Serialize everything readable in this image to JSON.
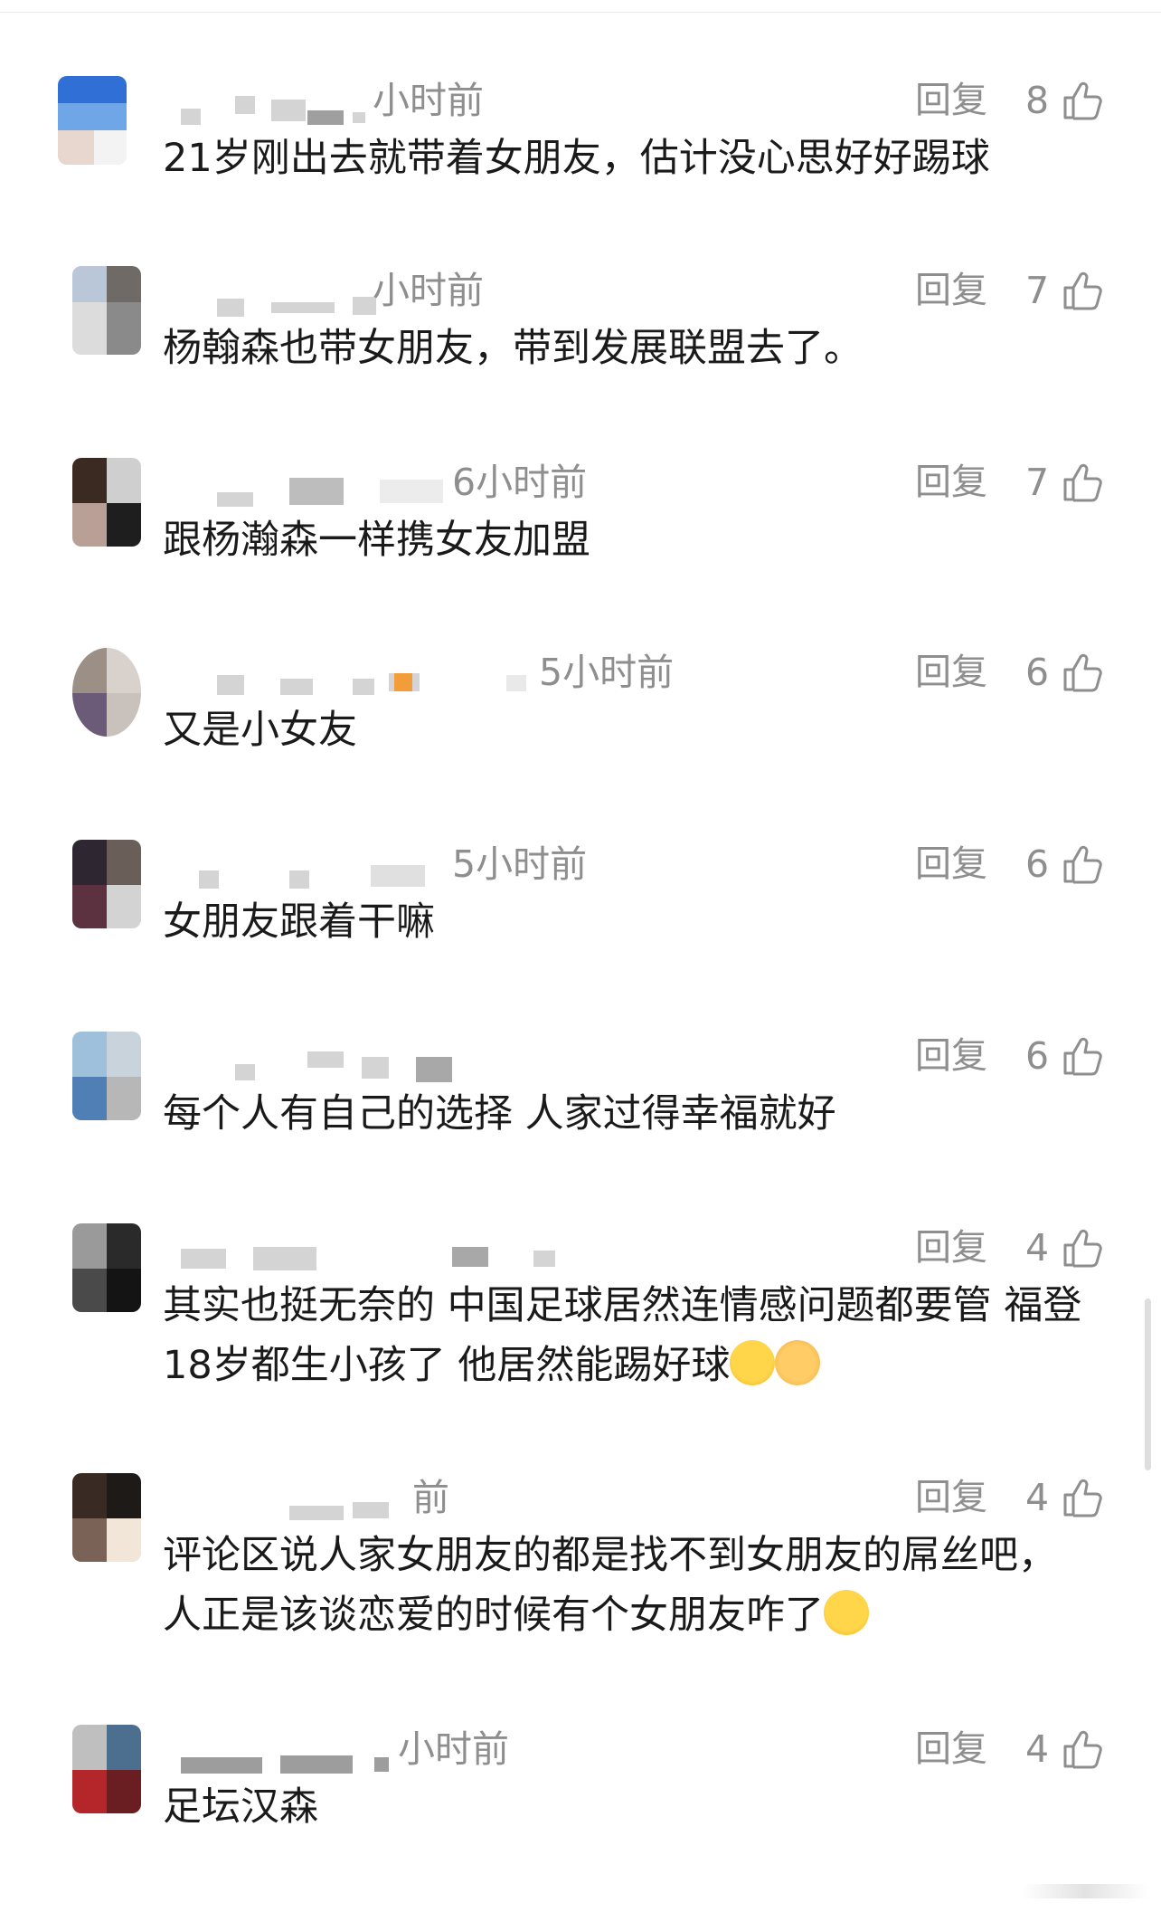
{
  "comments": [
    {
      "time": "小时前",
      "reply": "回复",
      "likes": "8",
      "text": "21岁刚出去就带着女朋友，估计没心思好好踢球"
    },
    {
      "time": "小时前",
      "reply": "回复",
      "likes": "7",
      "text": "杨翰森也带女朋友，带到发展联盟去了。"
    },
    {
      "time": "6小时前",
      "reply": "回复",
      "likes": "7",
      "text": "跟杨瀚森一样携女友加盟"
    },
    {
      "time": "5小时前",
      "reply": "回复",
      "likes": "6",
      "text": "又是小女友"
    },
    {
      "time": "5小时前",
      "reply": "回复",
      "likes": "6",
      "text": "女朋友跟着干嘛"
    },
    {
      "time": "",
      "reply": "回复",
      "likes": "6",
      "text": "每个人有自己的选择 人家过得幸福就好"
    },
    {
      "time": "",
      "reply": "回复",
      "likes": "4",
      "text": "其实也挺无奈的 中国足球居然连情感问题都要管 福登18岁都生小孩了 他居然能踢好球",
      "emojis": [
        "laugh-cry",
        "ok-hand"
      ]
    },
    {
      "time": "前",
      "reply": "回复",
      "likes": "4",
      "text": "评论区说人家女朋友的都是找不到女朋友的屌丝吧，人正是该谈恋爱的时候有个女朋友咋了",
      "emojis": [
        "laugh-cry"
      ]
    },
    {
      "time": "小时前",
      "reply": "回复",
      "likes": "4",
      "text": "足坛汉森"
    }
  ],
  "colors": {
    "meta": "#8e8e8e",
    "text": "#1a1a1a",
    "background": "#ffffff"
  }
}
